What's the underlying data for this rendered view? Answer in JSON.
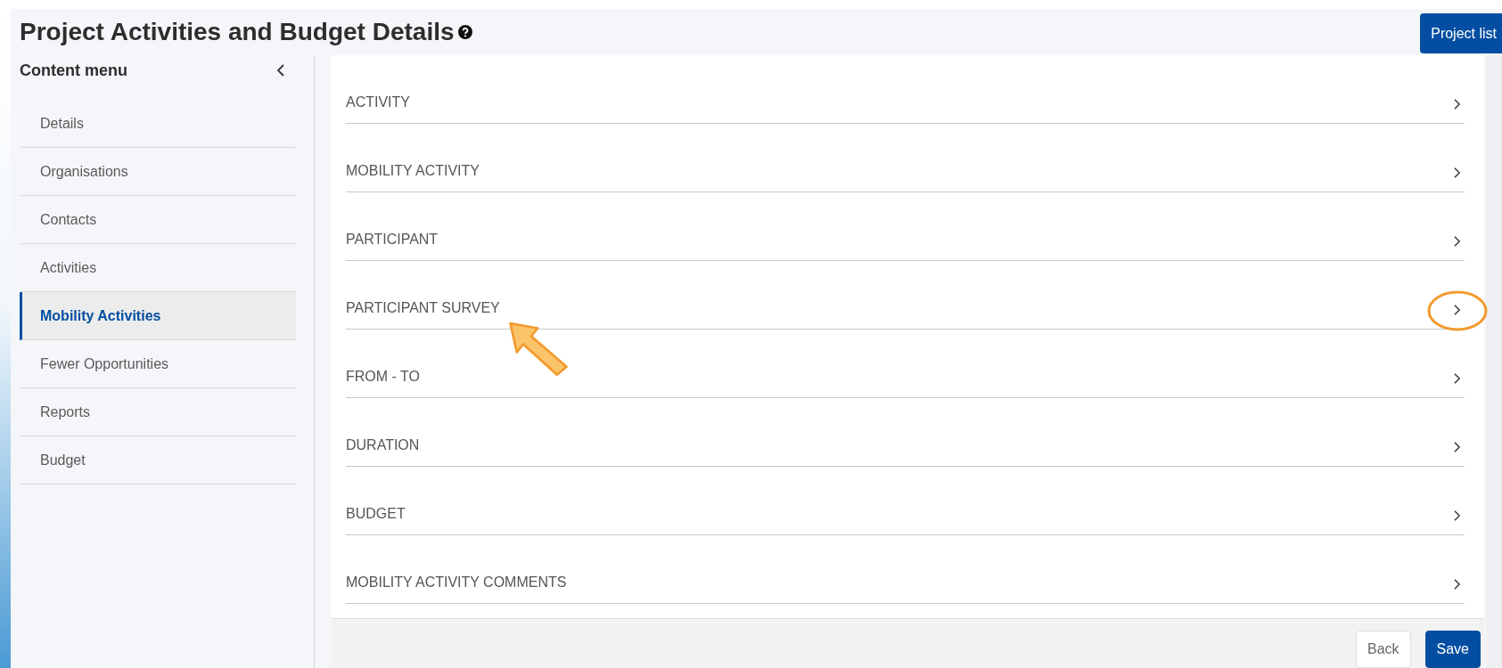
{
  "page_title": "Project Activities and Budget Details",
  "project_list_button": "Project list",
  "sidebar": {
    "title": "Content menu",
    "items": [
      {
        "label": "Details",
        "selected": false
      },
      {
        "label": "Organisations",
        "selected": false
      },
      {
        "label": "Contacts",
        "selected": false
      },
      {
        "label": "Activities",
        "selected": false
      },
      {
        "label": "Mobility Activities",
        "selected": true
      },
      {
        "label": "Fewer Opportunities",
        "selected": false
      },
      {
        "label": "Reports",
        "selected": false
      },
      {
        "label": "Budget",
        "selected": false
      }
    ]
  },
  "sections": [
    {
      "label": "ACTIVITY",
      "highlighted": false
    },
    {
      "label": "MOBILITY ACTIVITY",
      "highlighted": false
    },
    {
      "label": "PARTICIPANT",
      "highlighted": false
    },
    {
      "label": "PARTICIPANT SURVEY",
      "highlighted": true
    },
    {
      "label": "FROM - TO",
      "highlighted": false
    },
    {
      "label": "DURATION",
      "highlighted": false
    },
    {
      "label": "BUDGET",
      "highlighted": false
    },
    {
      "label": "MOBILITY ACTIVITY COMMENTS",
      "highlighted": false
    }
  ],
  "footer_buttons": [
    {
      "label": "Back",
      "kind": "secondary"
    },
    {
      "label": "Save",
      "kind": "primary"
    }
  ]
}
